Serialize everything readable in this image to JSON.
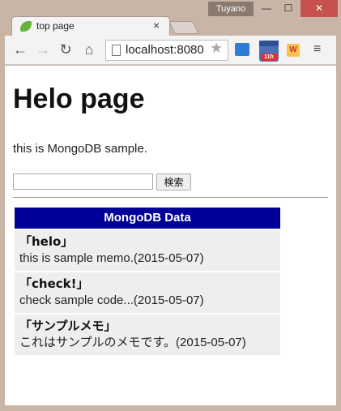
{
  "window": {
    "user_name": "Tuyano",
    "minimize_glyph": "—",
    "maximize_glyph": "☐",
    "close_glyph": "✕"
  },
  "tab": {
    "title": "top page",
    "close_glyph": "×",
    "favicon": "leaf-icon"
  },
  "toolbar": {
    "back_glyph": "←",
    "forward_glyph": "→",
    "reload_glyph": "↻",
    "home_glyph": "⌂",
    "url": "localhost:8080",
    "star_glyph": "★",
    "calendar_badge": "11h",
    "ext_badge": "W",
    "menu_glyph": "≡"
  },
  "page": {
    "title": "Helo page",
    "message": "this is MongoDB sample.",
    "search": {
      "value": "",
      "button_label": "検索"
    }
  },
  "table": {
    "header": "MongoDB Data",
    "rows": [
      {
        "title": "「helo」",
        "body": "this is sample memo.(2015-05-07)"
      },
      {
        "title": "「check!」",
        "body": "check sample code...(2015-05-07)"
      },
      {
        "title": "「サンプルメモ」",
        "body": "これはサンプルのメモです。(2015-05-07)"
      }
    ]
  },
  "colors": {
    "table_header_bg": "#000099",
    "row_bg": "#eeeeee",
    "window_frame": "#c9b5a7",
    "close_button": "#c7514c"
  }
}
